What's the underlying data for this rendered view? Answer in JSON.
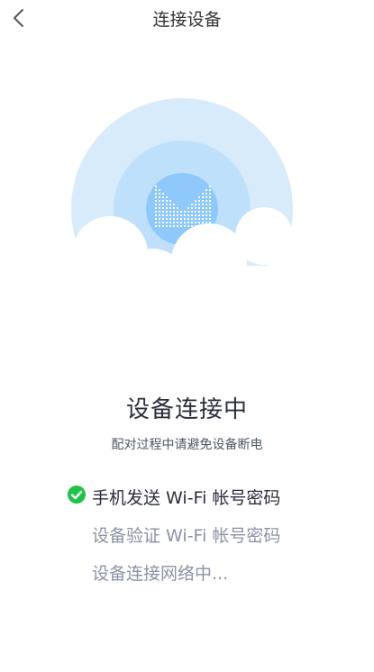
{
  "header": {
    "title": "连接设备",
    "back_icon": "chevron-left-icon"
  },
  "illustration": {
    "icon": "router-signal-icon",
    "colors": {
      "outer": "#d7ebfb",
      "middle": "#bfe0fb",
      "inner": "#8fc9fb",
      "cloud": "#ffffff"
    }
  },
  "status": {
    "title": "设备连接中",
    "subtitle": "配对过程中请避免设备断电"
  },
  "steps": [
    {
      "label": "手机发送 Wi-Fi 帐号密码",
      "state": "done",
      "icon": "check-circle-icon"
    },
    {
      "label": "设备验证 Wi-Fi 帐号密码",
      "state": "pending"
    },
    {
      "label": "设备连接网络中...",
      "state": "pending"
    }
  ],
  "colors": {
    "success": "#21c24a",
    "text_primary": "#2b2f3a",
    "text_muted": "#8b92a6"
  }
}
